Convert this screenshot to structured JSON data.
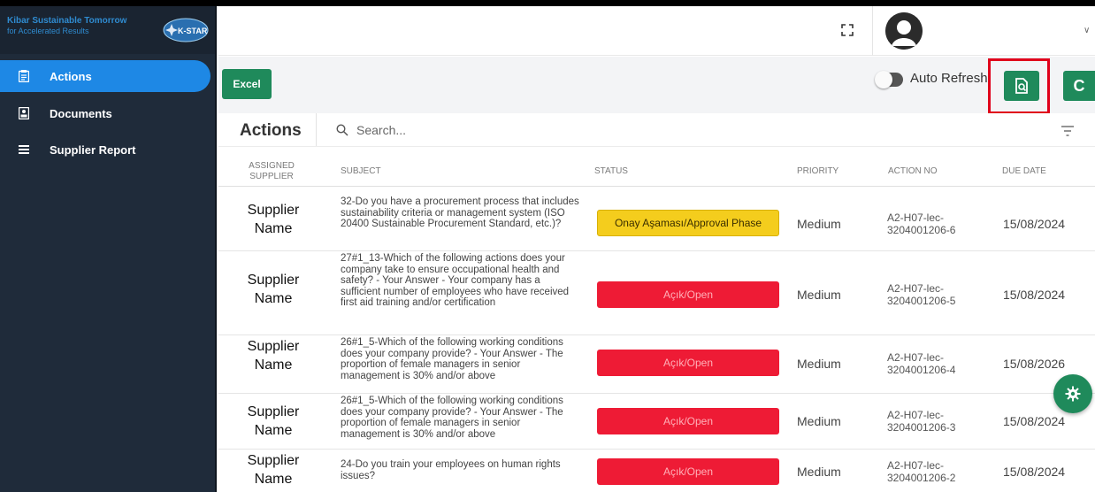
{
  "brand": {
    "line1": "Kibar Sustainable Tomorrow",
    "line2": "for Accelerated Results",
    "logo_text": "K-STAR"
  },
  "sidebar": {
    "items": [
      {
        "label": "Actions",
        "icon": "clipboard-icon",
        "active": true
      },
      {
        "label": "Documents",
        "icon": "id-card-icon",
        "active": false
      },
      {
        "label": "Supplier Report",
        "icon": "list-icon",
        "active": false
      }
    ]
  },
  "topbar": {
    "fullscreen_icon": "fullscreen-icon",
    "avatar_icon": "user-avatar-icon"
  },
  "toolbar": {
    "excel_label": "Excel",
    "auto_refresh_label": "Auto Refresh",
    "auto_refresh_on": false,
    "report_icon": "document-search-icon",
    "refresh_label": "C"
  },
  "panel": {
    "title": "Actions",
    "search_placeholder": "Search..."
  },
  "table": {
    "headers": [
      "ASSIGNED SUPPLIER",
      "SUBJECT",
      "STATUS",
      "PRIORITY",
      "ACTION NO",
      "DUE DATE"
    ],
    "rows": [
      {
        "supplier": "Supplier Name",
        "subject": "32-Do you have a procurement process that includes sustainability criteria or management system (ISO 20400 Sustainable Procurement Standard, etc.)?",
        "status": "Onay Aşaması/Approval Phase",
        "status_type": "approval",
        "priority": "Medium",
        "action_no": "A2-H07-lec-3204001206-6",
        "due_date": "15/08/2024"
      },
      {
        "supplier": "Supplier Name",
        "subject": "27#1_13-Which of the following actions does your company take to ensure occupational health and safety? - Your Answer - Your company has a sufficient number of employees who have received first aid training and/or certification",
        "status": "Açık/Open",
        "status_type": "open",
        "priority": "Medium",
        "action_no": "A2-H07-lec-3204001206-5",
        "due_date": "15/08/2024"
      },
      {
        "supplier": "Supplier Name",
        "subject": "26#1_5-Which of the following working conditions does your company provide? - Your Answer - The proportion of female managers in senior management is 30% and/or above",
        "status": "Açık/Open",
        "status_type": "open",
        "priority": "Medium",
        "action_no": "A2-H07-lec-3204001206-4",
        "due_date": "15/08/2026"
      },
      {
        "supplier": "Supplier Name",
        "subject": "26#1_5-Which of the following working conditions does your company provide? - Your Answer - The proportion of female managers in senior management is 30% and/or above",
        "status": "Açık/Open",
        "status_type": "open",
        "priority": "Medium",
        "action_no": "A2-H07-lec-3204001206-3",
        "due_date": "15/08/2024"
      },
      {
        "supplier": "Supplier Name",
        "subject": "24-Do you train your employees on human rights issues?",
        "status": "Açık/Open",
        "status_type": "open",
        "priority": "Medium",
        "action_no": "A2-H07-lec-3204001206-2",
        "due_date": "15/08/2024"
      }
    ]
  },
  "fab": {
    "icon": "settings-gear-icon"
  },
  "colors": {
    "sidebar_bg": "#1f2b3a",
    "active_nav": "#1e88e5",
    "primary_green": "#1f8a5b",
    "open_red": "#ee1b35",
    "approval_yellow": "#f4cd1d",
    "highlight_red": "#e0001b"
  }
}
